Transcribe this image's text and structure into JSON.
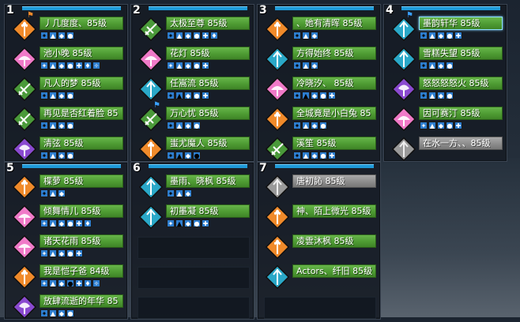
{
  "groups": [
    {
      "num": "1",
      "members": [
        {
          "name": "丿几度度、85级",
          "cls": "orange",
          "flag": "orange",
          "buffs": [
            "y",
            "g",
            "k",
            "g"
          ]
        },
        {
          "name": "池小晚 85级",
          "cls": "pink",
          "buffs": [
            "p",
            "p",
            "b",
            "p",
            "k",
            "p",
            "p"
          ]
        },
        {
          "name": "凡人的梦   85级",
          "cls": "green",
          "buffs": [
            "y",
            "g",
            "k",
            "b"
          ]
        },
        {
          "name": "再见是否红着脸 85",
          "cls": "green",
          "buffs": [
            "y",
            "g",
            "k",
            "g"
          ]
        },
        {
          "name": "清弦 85级",
          "cls": "purple",
          "buffs": [
            "y",
            "g",
            "k",
            "g"
          ]
        }
      ]
    },
    {
      "num": "2",
      "members": [
        {
          "name": "太极至尊 85级",
          "cls": "green",
          "buffs": [
            "y",
            "g",
            "k",
            "g",
            "k",
            "b"
          ]
        },
        {
          "name": "花灯 85级",
          "cls": "pink",
          "buffs": [
            "p",
            "p",
            "g",
            "k",
            "g"
          ]
        },
        {
          "name": "任嵩流 85级",
          "cls": "cyan",
          "buffs": [
            "y",
            "y",
            "g",
            "k",
            "g"
          ]
        },
        {
          "name": "万心忧 85级",
          "cls": "green",
          "flag": "blue",
          "buffs": [
            "y",
            "g",
            "k",
            "g"
          ]
        },
        {
          "name": "蚩尤魔人 85级",
          "cls": "orange",
          "buffs": [
            "y",
            "y",
            "g",
            "y"
          ]
        }
      ]
    },
    {
      "num": "3",
      "members": [
        {
          "name": "、她有清晖 85级",
          "cls": "orange",
          "buffs": [
            "y",
            "g",
            "k"
          ]
        },
        {
          "name": "方得始终 85级",
          "cls": "cyan",
          "buffs": [
            "y",
            "g",
            "k"
          ]
        },
        {
          "name": "冷晓汐、 85级",
          "cls": "pink",
          "buffs": [
            "y",
            "y",
            "g",
            "k",
            "g"
          ]
        },
        {
          "name": "全城竟是小白兔 85",
          "cls": "orange",
          "buffs": [
            "y",
            "g",
            "k",
            "g"
          ]
        },
        {
          "name": "溪笙 85级",
          "cls": "green",
          "buffs": [
            "y",
            "g",
            "k",
            "g",
            "b"
          ]
        }
      ]
    },
    {
      "num": "4",
      "members": [
        {
          "name": "墨韵轩华 85级",
          "cls": "cyan",
          "flag": "blue",
          "sel": true,
          "buffs": [
            "y",
            "p",
            "k",
            "g",
            "g"
          ]
        },
        {
          "name": "雪糕失望 85级",
          "cls": "cyan",
          "buffs": [
            "y",
            "g",
            "k",
            "g"
          ]
        },
        {
          "name": "怒怒怒怒火 85级",
          "cls": "purple",
          "buffs": [
            "y",
            "g",
            "k",
            "g"
          ]
        },
        {
          "name": "因可赛汀 85级",
          "cls": "pink",
          "buffs": [
            "p",
            "p",
            "g",
            "k",
            "g"
          ]
        },
        {
          "name": "在水一方、、85级",
          "cls": "gray",
          "gray": true,
          "buffs": []
        }
      ]
    },
    {
      "num": "5",
      "members": [
        {
          "name": "楪萝 85级",
          "cls": "orange",
          "buffs": [
            "y",
            "g",
            "k"
          ]
        },
        {
          "name": "倾舞情儿 85级",
          "cls": "pink",
          "buffs": [
            "p",
            "p",
            "g",
            "k",
            "p",
            "p"
          ]
        },
        {
          "name": "诸天花雨 85级",
          "cls": "pink",
          "buffs": [
            "p",
            "p",
            "g",
            "k",
            "g"
          ]
        },
        {
          "name": "我是恺子爸 84级",
          "cls": "orange",
          "buffs": [
            "p",
            "p",
            "g",
            "y",
            "g",
            "k",
            "g"
          ]
        },
        {
          "name": "放肆流逝的年华 85",
          "cls": "purple",
          "buffs": [
            "y",
            "g",
            "k",
            "g"
          ]
        }
      ]
    },
    {
      "num": "6",
      "members": [
        {
          "name": "墨雨、晓枫 85级",
          "cls": "cyan",
          "buffs": [
            "y",
            "g",
            "k"
          ]
        },
        {
          "name": "初墨凝 85级",
          "cls": "cyan",
          "buffs": [
            "k",
            "y",
            "g",
            "k",
            "g"
          ]
        }
      ]
    },
    {
      "num": "7",
      "members": [
        {
          "name": "唐初訫 85级",
          "cls": "gray",
          "gray": true,
          "buffs": []
        },
        {
          "name": "神、陌上微光 85级",
          "cls": "orange",
          "buffs": []
        },
        {
          "name": "凌雲沐枫 85级",
          "cls": "orange",
          "buffs": []
        },
        {
          "name": "Actors、纤旧 85级",
          "cls": "cyan",
          "buffs": []
        }
      ]
    }
  ],
  "class_colors": {
    "orange": "#f08a2a",
    "pink": "#f07ac8",
    "green": "#4a9a3a",
    "purple": "#8a4ad0",
    "cyan": "#2aa8c8",
    "gray": "#9a9a9a"
  }
}
